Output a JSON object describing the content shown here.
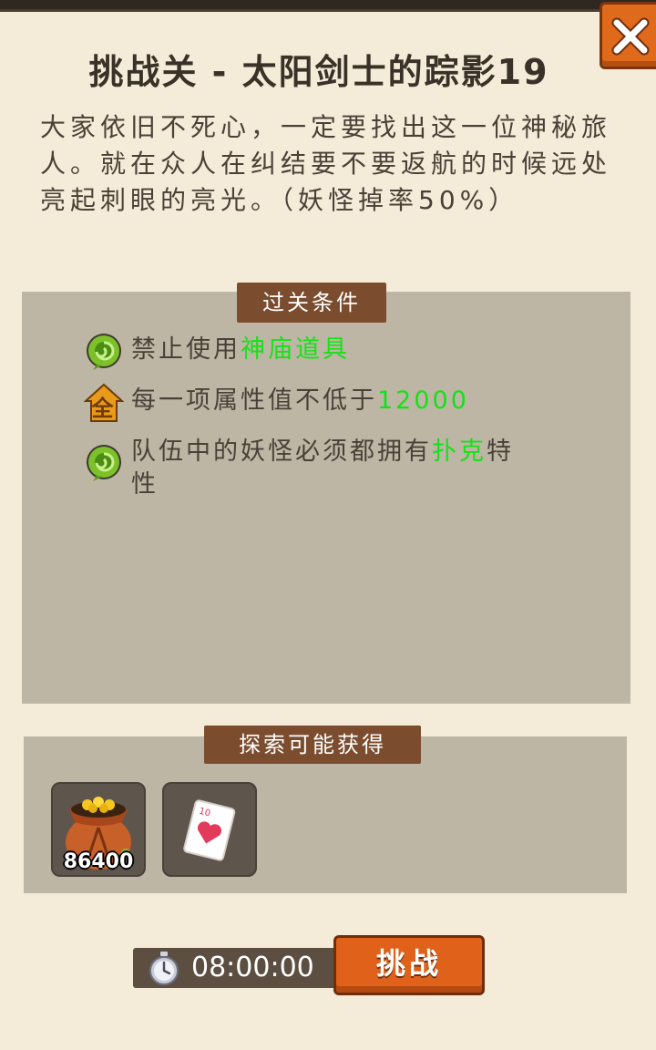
{
  "title": "挑战关 - 太阳剑士的踪影19",
  "description": "大家依旧不死心，一定要找出这一位神秘旅人。就在众人在纠结要不要返航的时候远处亮起刺眼的亮光。（妖怪掉率50%）",
  "conditions": {
    "header": "过关条件",
    "items": [
      {
        "icon": "green-swirl-icon",
        "prefix": "禁止使用",
        "highlight": "神庙道具",
        "suffix": ""
      },
      {
        "icon": "quan-badge-icon",
        "prefix": "每一项属性值不低于",
        "highlight": "12000",
        "suffix": ""
      },
      {
        "icon": "green-swirl-icon",
        "prefix": "队伍中的妖怪必须都拥有",
        "highlight": "扑克",
        "suffix": "特性"
      }
    ]
  },
  "rewards": {
    "header": "探索可能获得",
    "items": [
      {
        "icon": "gold-coin-bag-icon",
        "count": "86400"
      },
      {
        "icon": "poker-card-icon",
        "count": ""
      }
    ]
  },
  "timer": "08:00:00",
  "challenge_label": "挑战",
  "colors": {
    "highlight": "#18e018",
    "accent": "#e0621a",
    "header_bg": "#7b4d2e",
    "panel_bg": "#f4ecd8",
    "box_bg": "#bdb6a4"
  }
}
